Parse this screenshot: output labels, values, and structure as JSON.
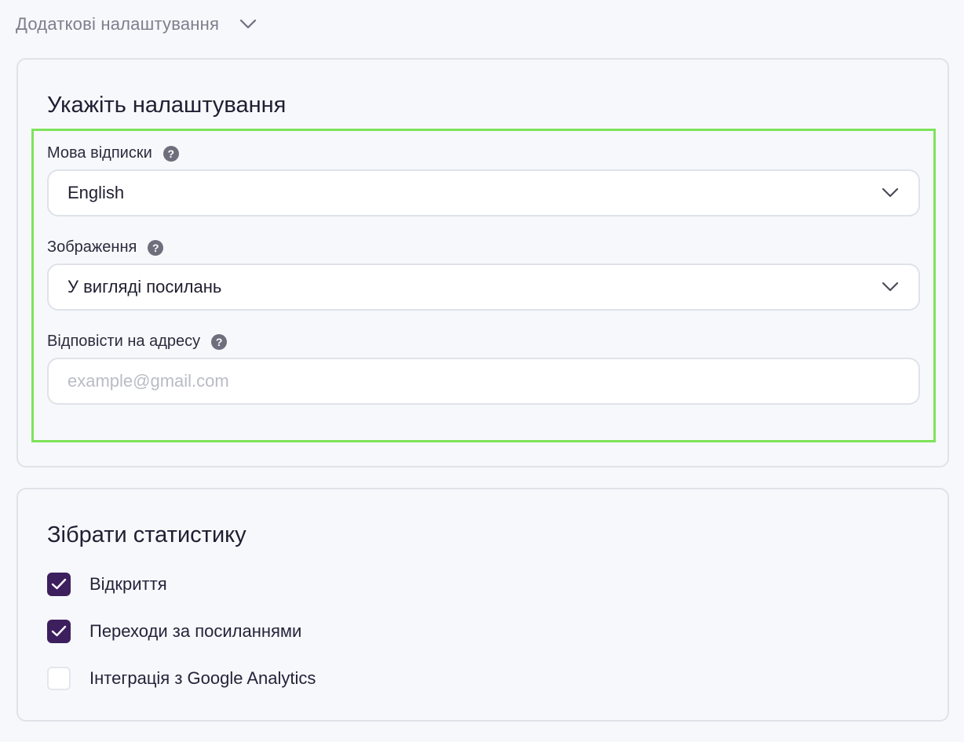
{
  "additional_settings": {
    "label": "Додаткові налаштування",
    "chevron_icon": "chevron-down-icon"
  },
  "settings_card": {
    "title": "Укажіть налаштування",
    "fields": {
      "unsubscribe_language": {
        "label": "Мова відписки",
        "help_icon": "question-circle-icon",
        "value": "English"
      },
      "images": {
        "label": "Зображення",
        "help_icon": "question-circle-icon",
        "value": "У вигляді посилань"
      },
      "reply_to": {
        "label": "Відповісти на адресу",
        "help_icon": "question-circle-icon",
        "value": "",
        "placeholder": "example@gmail.com"
      }
    }
  },
  "stats_card": {
    "title": "Зібрати статистику",
    "options": [
      {
        "label": "Відкриття",
        "checked": true
      },
      {
        "label": "Переходи за посиланнями",
        "checked": true
      },
      {
        "label": "Інтеграція з Google Analytics",
        "checked": false
      }
    ]
  },
  "colors": {
    "highlight": "#7ee35a",
    "checkbox_checked": "#3d1f5e",
    "border": "#dfe2e9"
  }
}
